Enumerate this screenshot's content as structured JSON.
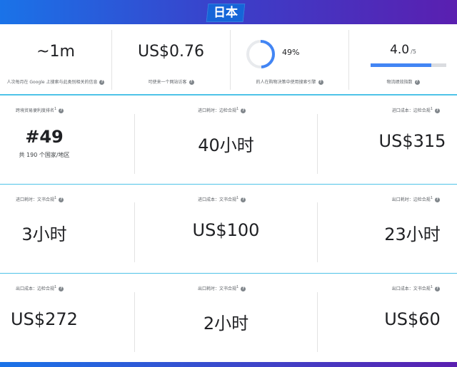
{
  "header": {
    "country": "日本"
  },
  "stats": {
    "searchers": {
      "value": "~1m",
      "label": "人次每月在 Google 上搜索与此类别相关的信息"
    },
    "cpc": {
      "value": "US$0.76",
      "label": "可使来一个网站访客"
    },
    "engine_share": {
      "value": "49%",
      "percent": 49,
      "label": "的人在购物决策中使用搜索引擎"
    },
    "logistics": {
      "value": "4.0",
      "denominator": "/5",
      "fraction": 0.8,
      "label": "物流绩效指数"
    }
  },
  "metrics": [
    {
      "label": "跨境贸易便利度排名",
      "sup": "1",
      "value": "#49",
      "sub": "共 190 个国家/地区"
    },
    {
      "label": "进口耗时：边检合规",
      "sup": "1",
      "value": "40小时"
    },
    {
      "label": "进口成本：边检合规",
      "sup": "1",
      "value": "US$315"
    },
    {
      "label": "进口耗时：文书合规",
      "sup": "1",
      "value": "3小时"
    },
    {
      "label": "进口成本：文书合规",
      "sup": "1",
      "value": "US$100"
    },
    {
      "label": "出口耗时：边检合规",
      "sup": "1",
      "value": "23小时"
    },
    {
      "label": "出口成本：边检合规",
      "sup": "1",
      "value": "US$272"
    },
    {
      "label": "出口耗时：文书合规",
      "sup": "1",
      "value": "2小时"
    },
    {
      "label": "出口成本：文书合规",
      "sup": "1",
      "value": "US$60"
    }
  ],
  "colors": {
    "accent": "#4285f4",
    "divider": "#4fc3e8",
    "brand_gradient_start": "#1a73e8",
    "brand_gradient_end": "#5a1fb0"
  },
  "icons": {
    "help": "question-circle-icon"
  }
}
